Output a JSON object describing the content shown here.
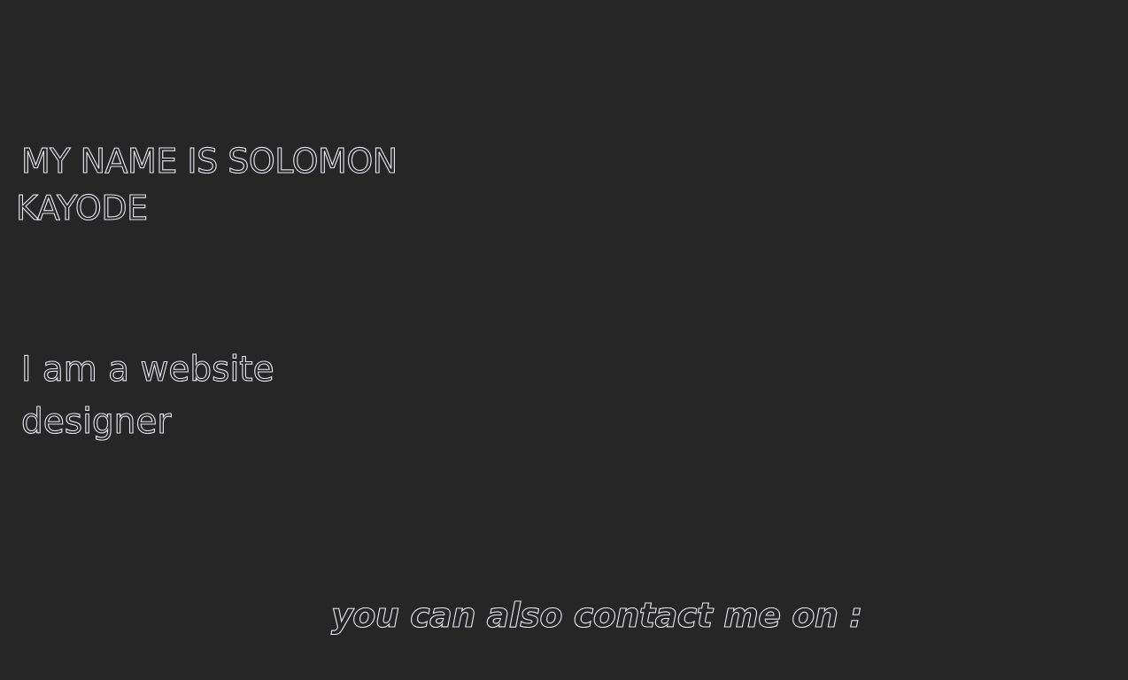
{
  "hero": {
    "name_line1": "MY NAME IS SOLOMON",
    "name_line2": "KAYODE"
  },
  "about": {
    "role_line1": "I am a website",
    "role_line2": "designer"
  },
  "contact": {
    "heading": "you can also contact me on :"
  },
  "colors": {
    "background": "#262626",
    "text_outline": "#e8e8ee"
  }
}
